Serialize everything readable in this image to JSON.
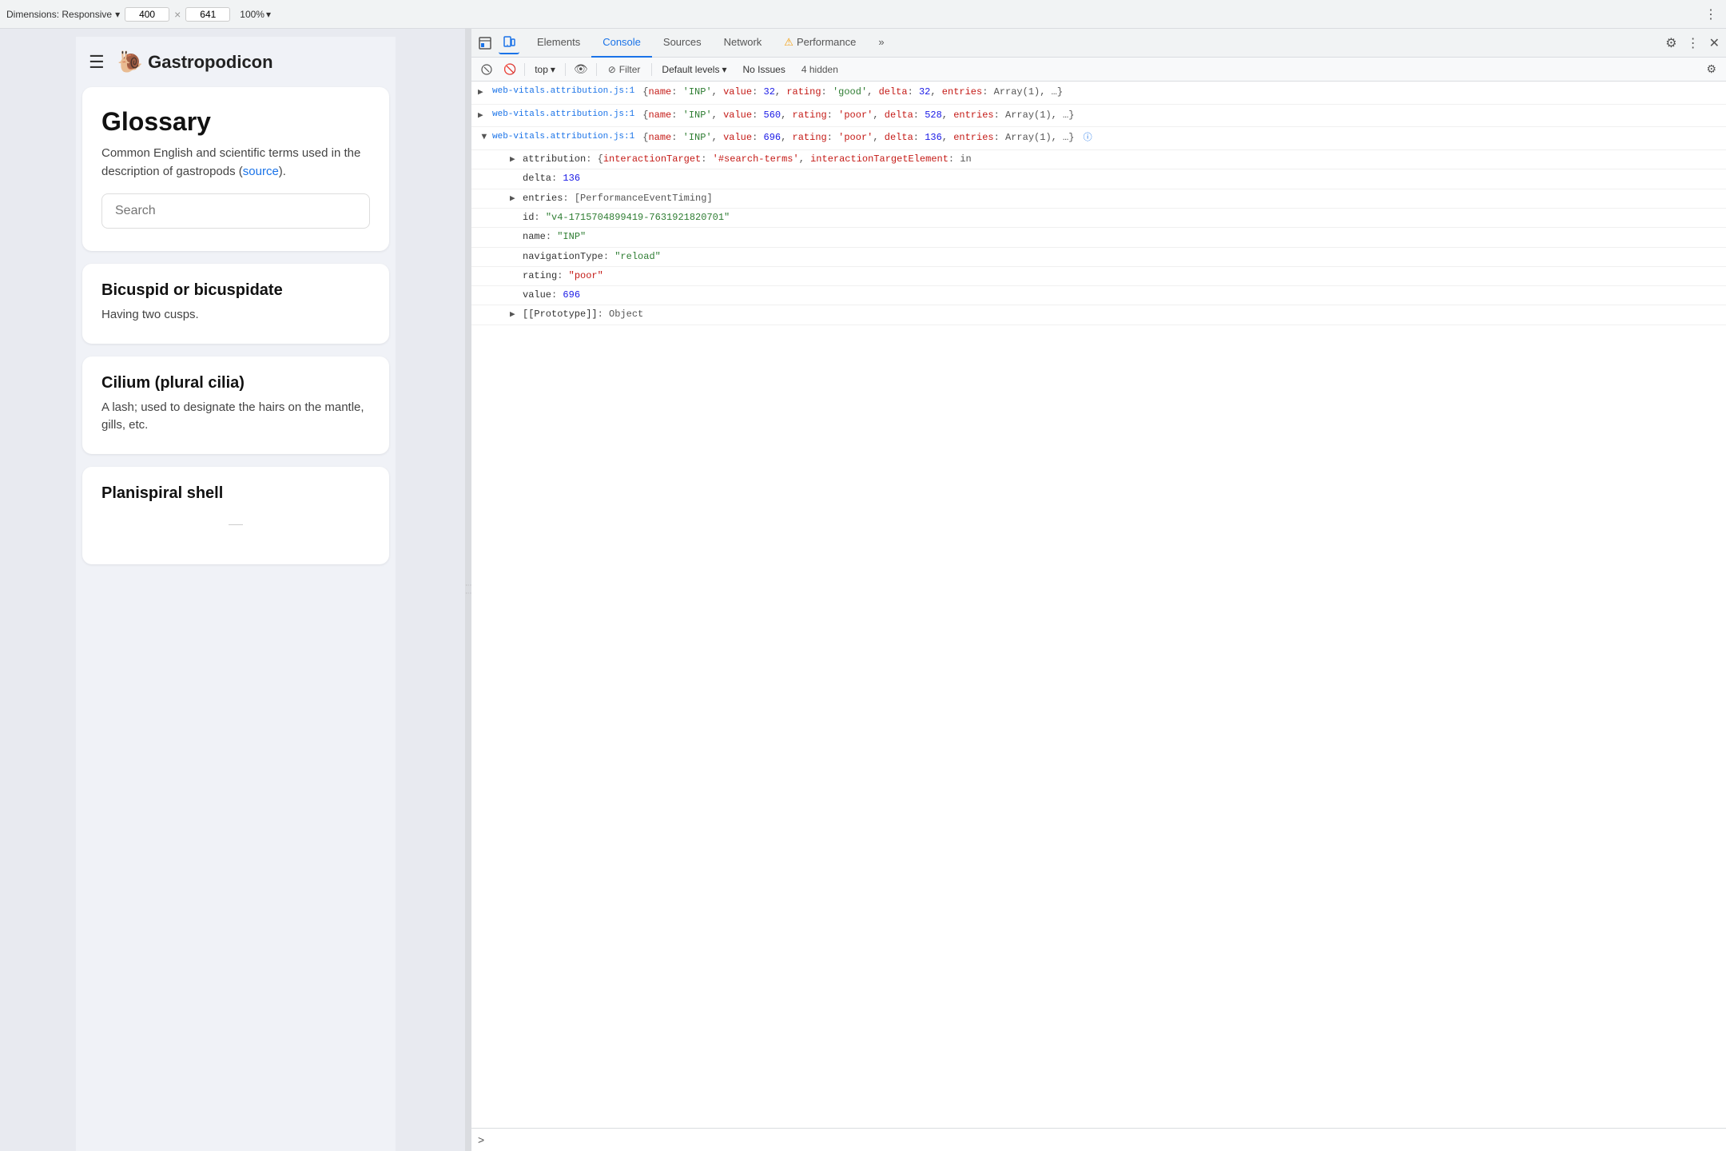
{
  "topToolbar": {
    "dimensionsLabel": "Dimensions: Responsive",
    "chevronIcon": "▾",
    "widthValue": "400",
    "separatorX": "×",
    "heightValue": "641",
    "zoomLabel": "100%",
    "zoomChevron": "▾",
    "moreIcon": "⋮"
  },
  "webpage": {
    "hamburgerIcon": "☰",
    "snailEmoji": "🐌",
    "siteTitle": "Gastropodicon",
    "glossaryCard": {
      "title": "Glossary",
      "subtitle": "Common English and scientific terms used in the description of gastropods (",
      "sourceLink": "source",
      "subtitleEnd": ").",
      "searchPlaceholder": "Search"
    },
    "terms": [
      {
        "title": "Bicuspid or bicuspidate",
        "definition": "Having two cusps."
      },
      {
        "title": "Cilium (plural cilia)",
        "definition": "A lash; used to designate the hairs on the mantle, gills, etc."
      },
      {
        "title": "Planispiral shell",
        "definition": ""
      }
    ]
  },
  "devtools": {
    "tabs": [
      {
        "label": "Elements",
        "active": false
      },
      {
        "label": "Console",
        "active": true
      },
      {
        "label": "Sources",
        "active": false
      },
      {
        "label": "Network",
        "active": false
      },
      {
        "label": "Performance",
        "active": false
      },
      {
        "label": "»",
        "active": false
      }
    ],
    "icons": {
      "settings": "⚙",
      "more": "⋮",
      "close": "✕"
    },
    "subtoolbar": {
      "inspectIcon": "⬜",
      "noEntriesIcon": "🚫",
      "contextTop": "top",
      "eyeIcon": "👁",
      "filterLabel": "Filter",
      "levelsLabel": "Default levels",
      "noIssues": "No Issues",
      "hiddenCount": "4 hidden",
      "settingsIcon": "⚙"
    },
    "consoleEntries": [
      {
        "id": "entry1",
        "collapsed": true,
        "link": "web-vitals.attribution.js:1",
        "content": "{name: 'INP', value: 32, rating: 'good', delta: 32, entries: Array(1), …}"
      },
      {
        "id": "entry2",
        "collapsed": true,
        "link": "web-vitals.attribution.js:1",
        "content": "{name: 'INP', value: 560, rating: 'poor', delta: 528, entries: Array(1), …}"
      },
      {
        "id": "entry3",
        "collapsed": false,
        "link": "web-vitals.attribution.js:1",
        "content": "{name: 'INP', value: 696, rating: 'poor', delta: 136, entries: Array(1), …}",
        "infoIcon": true,
        "children": [
          {
            "key": "attribution",
            "value": "{interactionTarget: '#search-terms', interactionTargetElement: in",
            "hasChildren": true,
            "indent": 1
          },
          {
            "key": "delta",
            "value": "136",
            "isNum": true,
            "indent": 2
          },
          {
            "key": "entries",
            "value": "[PerformanceEventTiming]",
            "hasChildren": true,
            "indent": 1
          },
          {
            "key": "id",
            "value": "\"v4-1715704899419-7631921820701\"",
            "isStr": true,
            "indent": 2
          },
          {
            "key": "name",
            "value": "\"INP\"",
            "isStr": true,
            "indent": 2
          },
          {
            "key": "navigationType",
            "value": "\"reload\"",
            "isStr": true,
            "indent": 2
          },
          {
            "key": "rating",
            "value": "\"poor\"",
            "isStr": true,
            "isPoor": true,
            "indent": 2
          },
          {
            "key": "value",
            "value": "696",
            "isNum": true,
            "indent": 2
          },
          {
            "key": "[[Prototype]]",
            "value": "Object",
            "hasChildren": true,
            "indent": 1
          }
        ]
      }
    ],
    "promptArrow": ">"
  }
}
